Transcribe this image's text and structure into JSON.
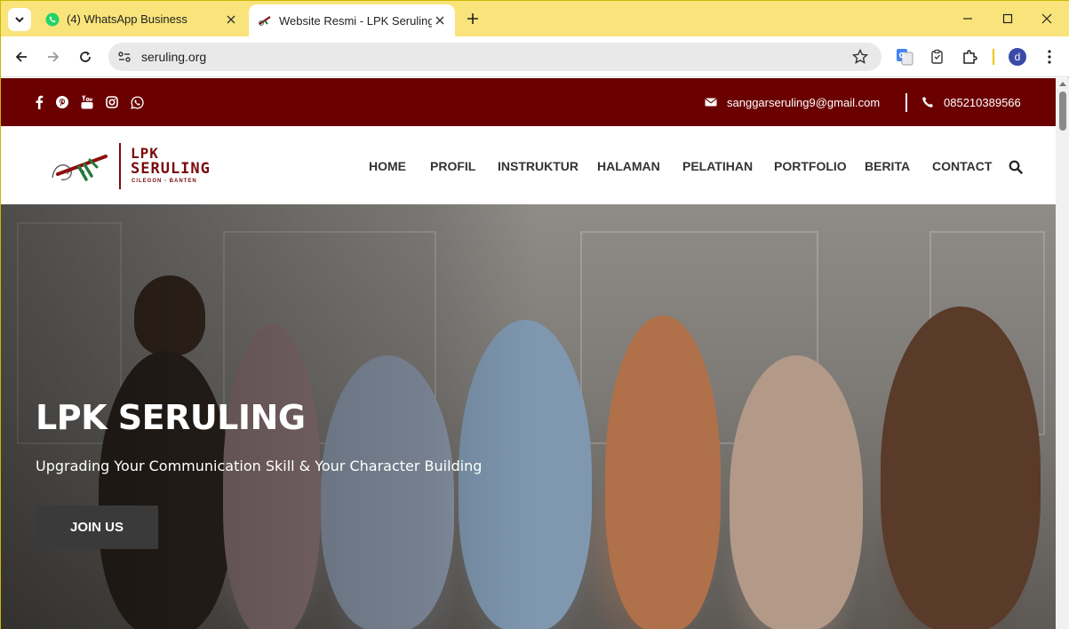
{
  "browser": {
    "tabs": [
      {
        "title": "(4) WhatsApp Business",
        "icon": "whatsapp-icon",
        "active": false
      },
      {
        "title": "Website Resmi - LPK Seruling",
        "icon": "site-favicon-icon",
        "active": true
      }
    ],
    "url": "seruling.org",
    "profile_initial": "d",
    "colors": {
      "tabbar": "#f8e47a",
      "omnibox": "#e9e9ea"
    }
  },
  "site": {
    "topbar": {
      "social_icons": [
        "facebook-icon",
        "pinterest-icon",
        "youtube-icon",
        "instagram-icon",
        "whatsapp-icon"
      ],
      "email": "sanggarseruling9@gmail.com",
      "phone": "085210389566",
      "color": "#6b0000"
    },
    "logo": {
      "line1": "LPK",
      "line2": "SERULING",
      "tagline": "CILEGON - BANTEN"
    },
    "menu": [
      "HOME",
      "PROFIL",
      "INSTRUKTUR",
      "HALAMAN",
      "PELATIHAN",
      "PORTFOLIO",
      "BERITA",
      "CONTACT"
    ],
    "hero": {
      "title": "LPK SERULING",
      "subtitle": "Upgrading Your Communication Skill & Your Character Building",
      "button": "JOIN US"
    }
  }
}
